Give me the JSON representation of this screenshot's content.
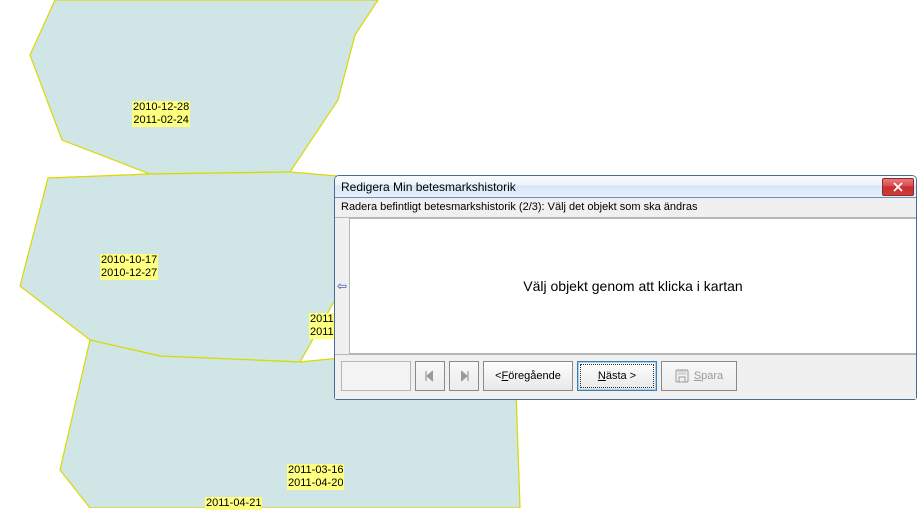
{
  "map": {
    "labels": [
      {
        "id": "label-1",
        "line1": "2010-12-28",
        "line2": "2011-02-24"
      },
      {
        "id": "label-2",
        "line1": "2010-10-17",
        "line2": "2010-12-27"
      },
      {
        "id": "label-3",
        "line1": "2011",
        "line2": "2011"
      },
      {
        "id": "label-4",
        "line1": "2011-03-16",
        "line2": "2011-04-20"
      },
      {
        "id": "label-5",
        "line1": "2011-04-21",
        "line2": ""
      }
    ]
  },
  "dialog": {
    "title": "Redigera Min betesmarkshistorik",
    "subtitle": "Radera befintligt betesmarkshistorik (2/3): Välj det objekt som ska ändras",
    "message": "Välj objekt genom att klicka i kartan",
    "buttons": {
      "prev_prefix": "< ",
      "prev_u": "F",
      "prev_rest": "öregående",
      "next_u": "N",
      "next_rest": "ästa >",
      "save_u": "S",
      "save_rest": "para"
    }
  }
}
